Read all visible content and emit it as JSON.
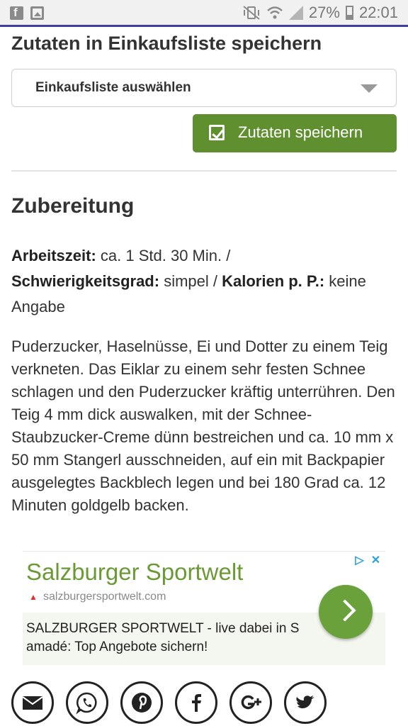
{
  "status_bar": {
    "battery": "27%",
    "time": "22:01",
    "left_icons": [
      "facebook-icon",
      "image-icon"
    ],
    "right_icons": [
      "vibrate-mute-icon",
      "wifi-icon",
      "signal-icon",
      "battery-icon"
    ]
  },
  "shopping": {
    "heading": "Zutaten in Einkaufsliste speichern",
    "select_label": "Einkaufsliste auswählen",
    "save_label": "Zutaten speichern"
  },
  "preparation": {
    "heading": "Zubereitung",
    "work_time_label": "Arbeitszeit:",
    "work_time_value": " ca. 1 Std. 30 Min. /",
    "difficulty_label": "Schwierigkeitsgrad:",
    "difficulty_value": " simpel / ",
    "calories_label": "Kalorien p. P.:",
    "calories_value": " keine Angabe",
    "instructions": "Puderzucker, Haselnüsse, Ei und Dotter zu einem Teig verkneten. Das Eiklar zu einem sehr festen Schnee schlagen und den Puderzucker kräftig unterrühren. Den Teig 4 mm dick auswalken, mit der Schnee-Staubzucker-Creme dünn bestreichen und ca. 10 mm x 50 mm Stangerl ausschneiden, auf ein mit Backpapier ausgelegtes Backblech legen und bei 180 Grad ca. 12 Minuten goldgelb backen."
  },
  "ad": {
    "title": "Salzburger Sportwelt",
    "url": "salzburgersportwelt.com",
    "description_line1": "SALZBURGER SPORTWELT - live dabei in S",
    "description_line2": "amadé: Top Angebote sichern!",
    "brand_color": "#6b9a35"
  },
  "share": {
    "icons": [
      "email-icon",
      "whatsapp-icon",
      "pinterest-icon",
      "facebook-icon",
      "google-plus-icon",
      "twitter-icon"
    ]
  },
  "colors": {
    "button_green": "#5f8f2f",
    "status_accent": "#3e3ea0"
  }
}
